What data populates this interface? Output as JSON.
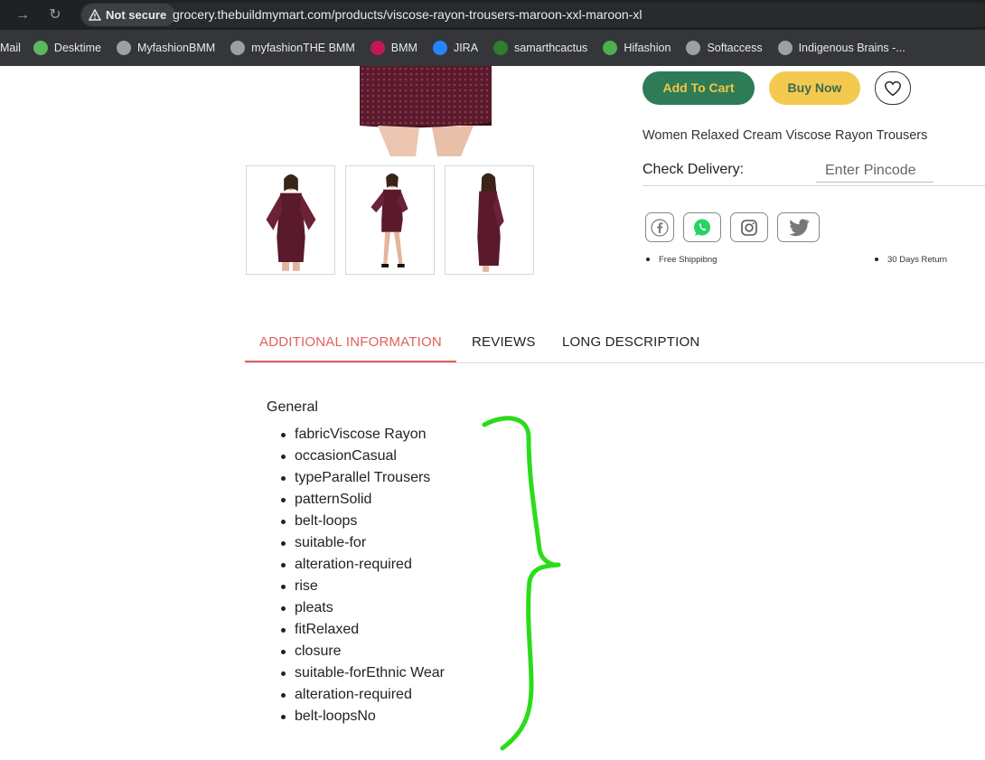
{
  "browser": {
    "security_label": "Not secure",
    "url": "grocery.thebuildmymart.com/products/viscose-rayon-trousers-maroon-xxl-maroon-xl",
    "bookmarks": [
      {
        "label": "Mail",
        "icon": "none",
        "color": ""
      },
      {
        "label": "Desktime",
        "icon": "desktime-icon",
        "color": "#5cb85c"
      },
      {
        "label": "MyfashionBMM",
        "icon": "globe-icon",
        "color": "#9aa0a6"
      },
      {
        "label": "myfashionTHE BMM",
        "icon": "globe-icon",
        "color": "#9aa0a6"
      },
      {
        "label": "BMM",
        "icon": "bmm-icon",
        "color": "#c2185b"
      },
      {
        "label": "JIRA",
        "icon": "jira-icon",
        "color": "#2684ff"
      },
      {
        "label": "samarthcactus",
        "icon": "cactus-icon",
        "color": "#2e7d32"
      },
      {
        "label": "Hifashion",
        "icon": "hifashion-icon",
        "color": "#4caf50"
      },
      {
        "label": "Softaccess",
        "icon": "globe-icon",
        "color": "#9aa0a6"
      },
      {
        "label": "Indigenous Brains -...",
        "icon": "globe-icon",
        "color": "#9aa0a6"
      }
    ]
  },
  "product": {
    "add_to_cart_label": "Add To Cart",
    "buy_now_label": "Buy Now",
    "name": "Women Relaxed Cream Viscose Rayon Trousers",
    "delivery_label": "Check Delivery:",
    "pincode_placeholder": "Enter Pincode",
    "features": [
      "Free Shippibng",
      "30 Days Return"
    ],
    "social": [
      "facebook-icon",
      "whatsapp-icon",
      "instagram-icon",
      "twitter-icon"
    ]
  },
  "colors": {
    "cart_bg": "#2e7b57",
    "buy_bg": "#f3c94f",
    "tab_active": "#e0605a",
    "dress": "#5a1a2c",
    "annotation": "#2bdc1a"
  },
  "tabs": [
    {
      "label": "ADDITIONAL INFORMATION",
      "active": true
    },
    {
      "label": "REVIEWS",
      "active": false
    },
    {
      "label": "LONG DESCRIPTION",
      "active": false
    }
  ],
  "additional_info": {
    "heading": "General",
    "items": [
      "fabricViscose Rayon",
      "occasionCasual",
      "typeParallel Trousers",
      "patternSolid",
      "belt-loops",
      "suitable-for",
      "alteration-required",
      "rise",
      "pleats",
      "fitRelaxed",
      "closure",
      "suitable-forEthnic Wear",
      "alteration-required",
      "belt-loopsNo"
    ]
  }
}
